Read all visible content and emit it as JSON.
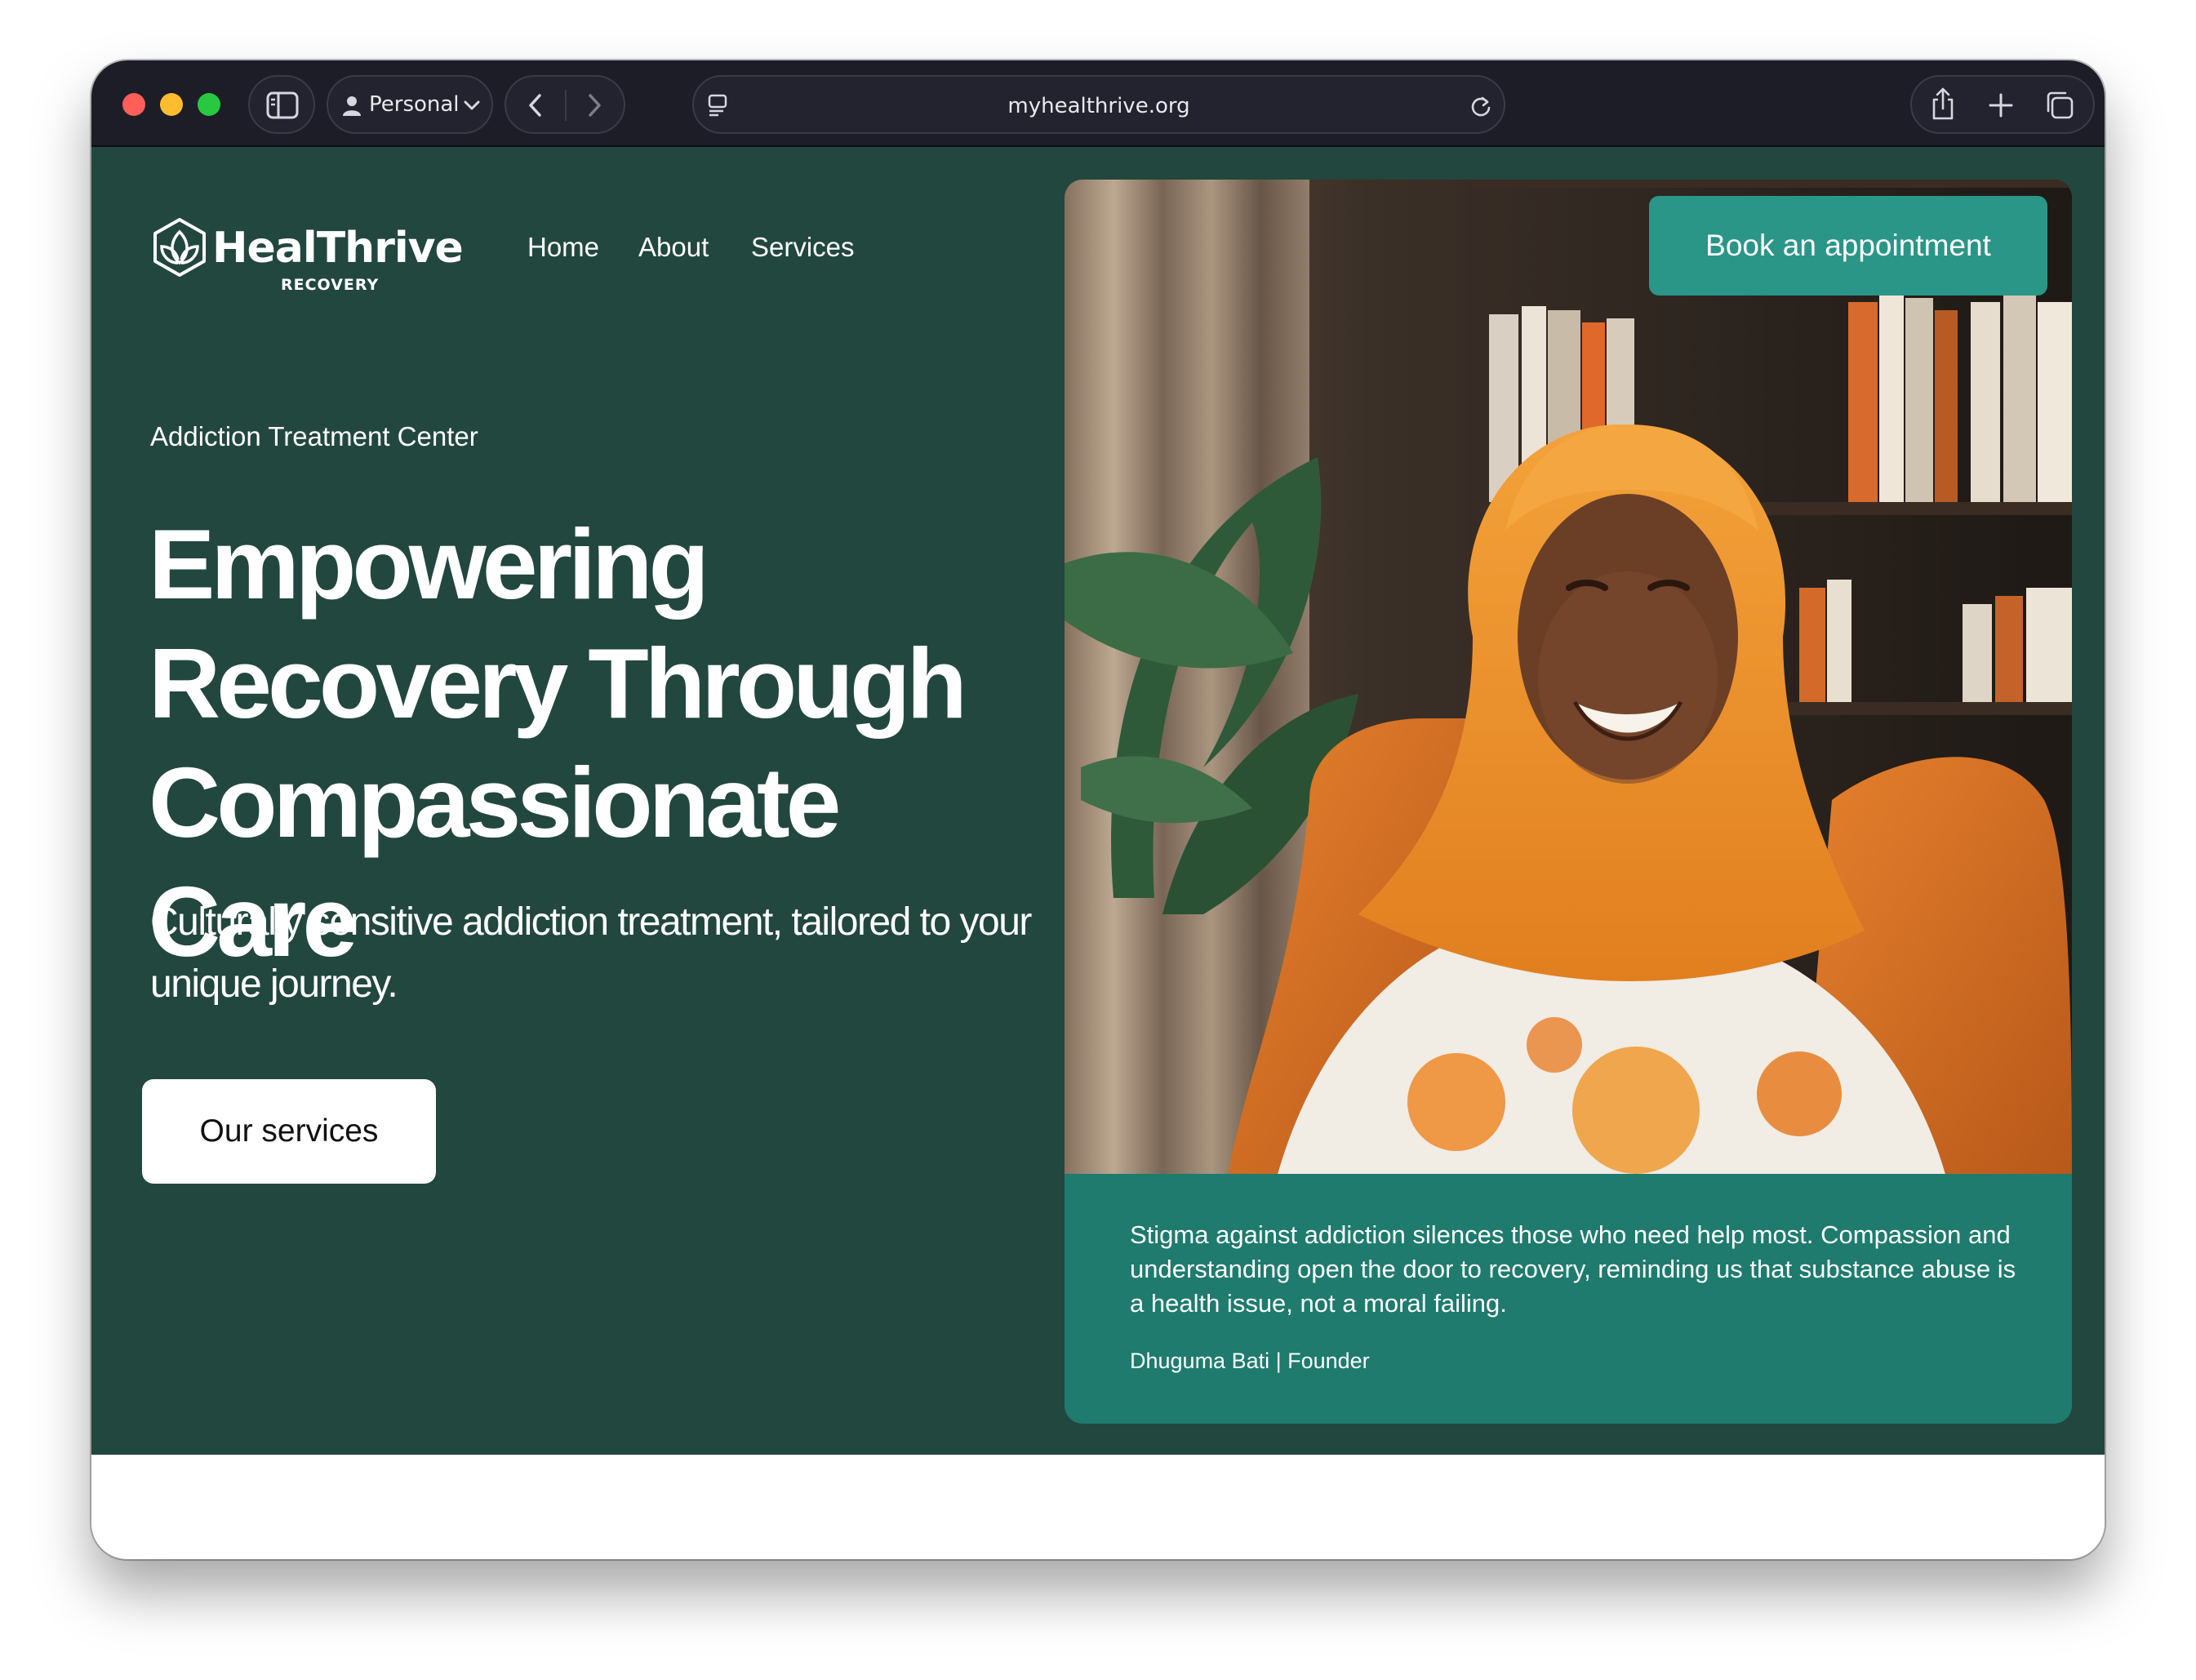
{
  "browser": {
    "profile_label": "Personal",
    "url": "myhealthrive.org",
    "icons": [
      "sidebar-toggle-icon",
      "person-icon",
      "chevron-down-icon",
      "back-arrow-icon",
      "forward-arrow-icon",
      "page-settings-icon",
      "reload-icon",
      "share-icon",
      "new-tab-plus-icon",
      "tabs-overview-icon"
    ]
  },
  "site": {
    "logo": {
      "name": "HealThrive",
      "tagline": "RECOVERY",
      "icon": "leaf-outline-icon"
    },
    "nav": [
      "Home",
      "About",
      "Services"
    ],
    "book_button": "Book an appointment",
    "hero": {
      "eyebrow": "Addiction Treatment Center",
      "headline_lines": [
        "Empowering",
        "Recovery Through",
        "Compassionate Care"
      ],
      "subheading": "Culturally sensitive addiction treatment, tailored to your unique journey.",
      "cta": "Our services"
    },
    "quote": {
      "text": "Stigma against addiction silences those who need help most. Compassion and understanding open the door to recovery, reminding us that substance abuse is a health issue, not a moral failing.",
      "author": "Dhuguma Bati | Founder"
    },
    "colors": {
      "page_background": "#22473e",
      "accent": "#2a9687",
      "quote_card": "#1e7b6e",
      "cta_background": "#ffffff",
      "browser_chrome": "#1c1d27"
    }
  }
}
